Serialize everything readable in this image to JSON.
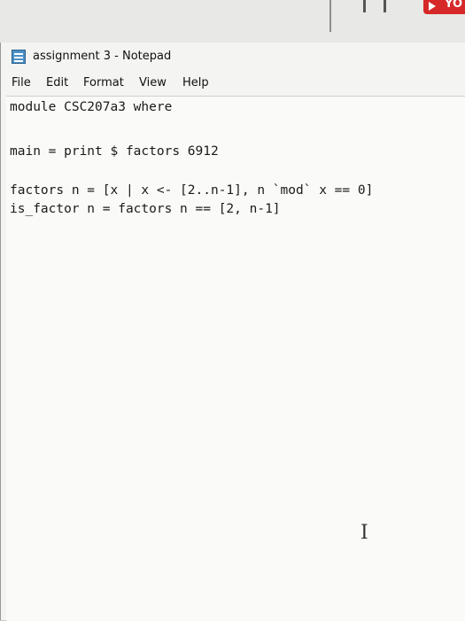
{
  "background": {
    "badge_text": "YO"
  },
  "window": {
    "title": "assignment 3 - Notepad"
  },
  "menu": {
    "items": [
      "File",
      "Edit",
      "Format",
      "View",
      "Help"
    ]
  },
  "editor": {
    "lines": [
      "module CSC207a3 where",
      "",
      "main = print $ factors 6912",
      "",
      "factors n = [x | x <- [2..n-1], n `mod` x == 0]",
      "is_factor n = factors n == [2, n-1]"
    ]
  },
  "colors": {
    "accent_badge": "#d62828",
    "window_bg": "#f4f4f2",
    "editor_bg": "#fafaf8"
  },
  "icons": {
    "app": "notepad-icon",
    "pointer": "text-cursor-icon"
  }
}
